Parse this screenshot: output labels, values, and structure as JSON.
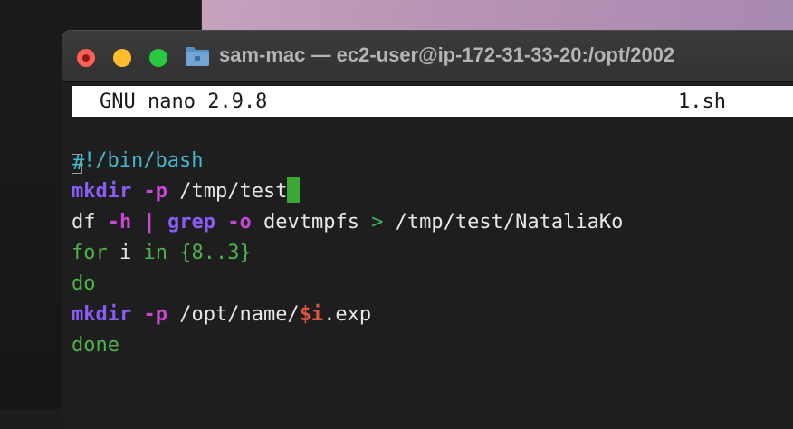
{
  "window": {
    "title": "sam-mac — ec2-user@ip-172-31-33-20:/opt/2002"
  },
  "nano": {
    "version": "GNU nano 2.9.8",
    "filename": "1.sh"
  },
  "code": {
    "line1": {
      "hash": "#",
      "rest": "!/bin/bash"
    },
    "line2": {
      "cmd": "mkdir",
      "flag": "-p",
      "arg": " /tmp/test"
    },
    "line3": {
      "cmd1": "df",
      "flag1": "-h",
      "pipe": "|",
      "cmd2": "grep",
      "flag2": "-o",
      "arg": " devtmpfs ",
      "redir": ">",
      "dest": " /tmp/test/NataliaKo"
    },
    "line4": {
      "kw1": "for",
      "var": " i ",
      "kw2": "in",
      "range": " {8..3}"
    },
    "line5": {
      "kw": "do"
    },
    "line6": {
      "cmd": "mkdir",
      "flag": "-p",
      "path": " /opt/name/",
      "var": "$i",
      "ext": ".exp"
    },
    "line7": {
      "kw": "done"
    }
  },
  "colors": {
    "close": "#ff5f57",
    "minimize": "#febc2e",
    "maximize": "#28c840",
    "cursor": "#3aa832"
  }
}
